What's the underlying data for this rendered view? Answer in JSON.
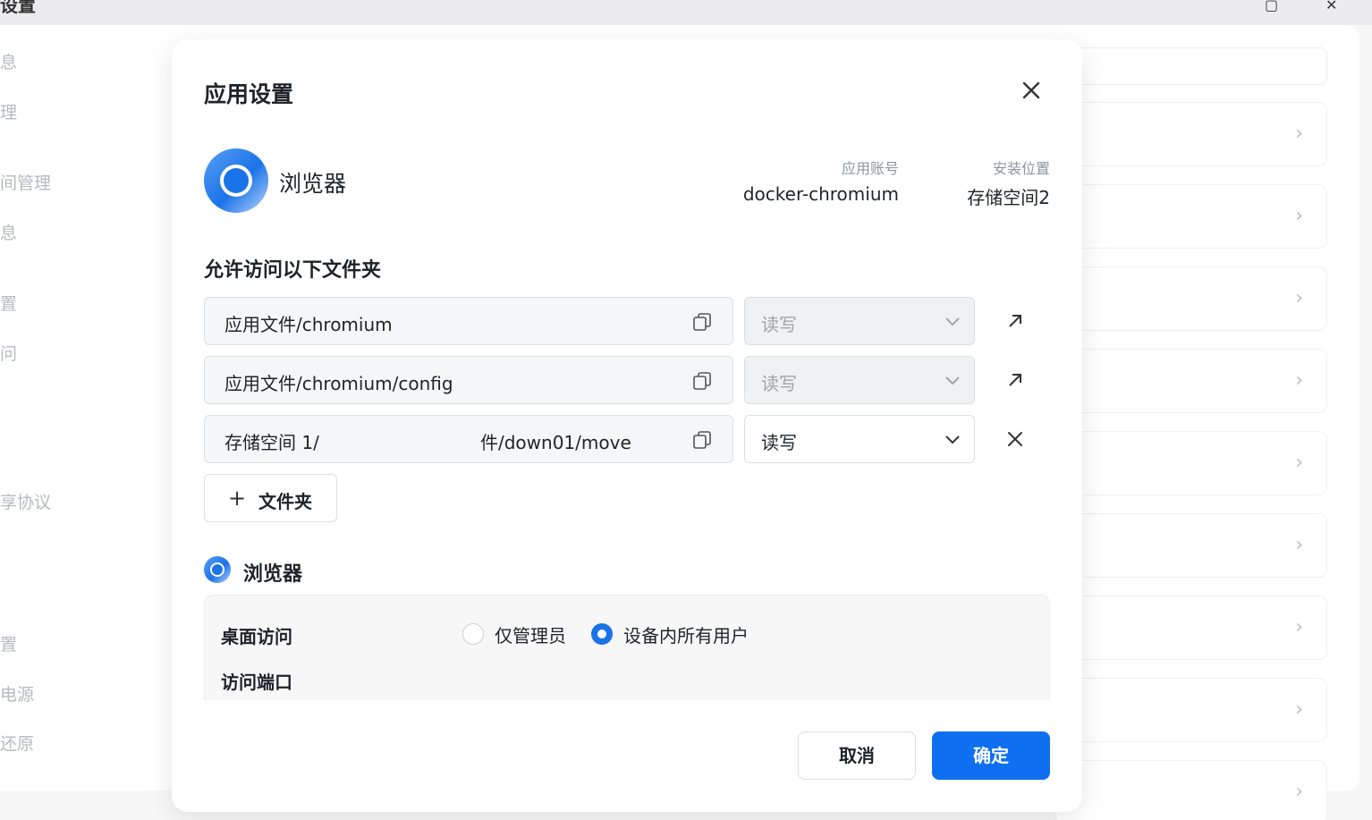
{
  "background": {
    "window_title": "设置",
    "sidebar_items": [
      "息",
      "理",
      "间管理",
      "息",
      "置",
      "问",
      "享协议",
      "置",
      "电源",
      "还原"
    ]
  },
  "dialog": {
    "title": "应用设置",
    "app": {
      "name": "浏览器",
      "account_label": "应用账号",
      "account_value": "docker-chromium",
      "location_label": "安装位置",
      "location_value": "存储空间2"
    },
    "folders_title": "允许访问以下文件夹",
    "folders": [
      {
        "path": "应用文件/chromium",
        "permission": "读写",
        "editable": false,
        "action": "open-link-icon"
      },
      {
        "path": "应用文件/chromium/config",
        "permission": "读写",
        "editable": false,
        "action": "open-link-icon"
      },
      {
        "path_start": "存储空间 1/",
        "path_end": "件/down01/move",
        "permission": "读写",
        "editable": true,
        "action": "remove-icon"
      }
    ],
    "add_folder_label": "文件夹",
    "section": {
      "title": "浏览器",
      "desktop_access_label": "桌面访问",
      "options": [
        "仅管理员",
        "设备内所有用户"
      ],
      "selected_option": "设备内所有用户",
      "port_label": "访问端口"
    },
    "cancel_label": "取消",
    "ok_label": "确定"
  },
  "colors": {
    "primary": "#0e6ff0",
    "app_icon": "#1a73e8"
  }
}
